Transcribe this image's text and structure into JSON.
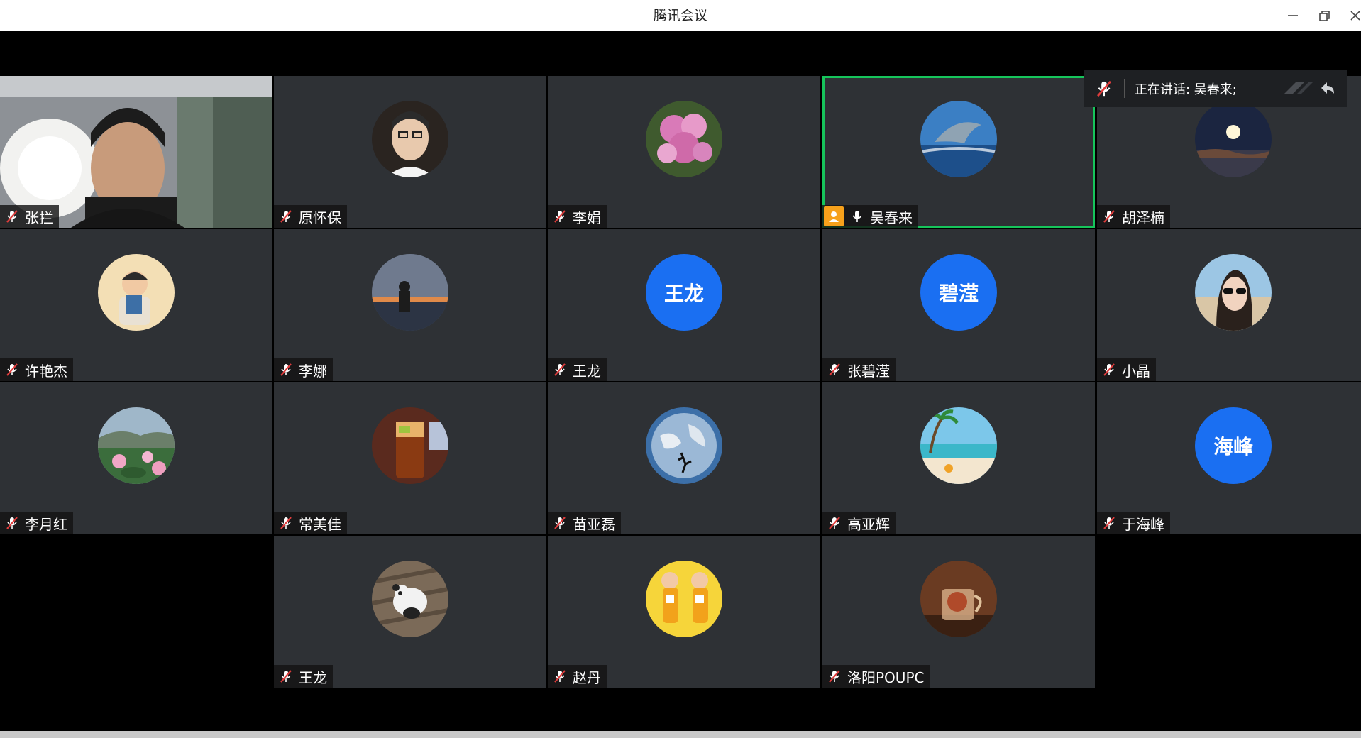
{
  "window": {
    "title": "腾讯会议"
  },
  "speaking": {
    "label": "正在讲话: 吴春来;"
  },
  "colors": {
    "active_border": "#16c55b",
    "text_avatar": "#1a6ff2",
    "host_badge": "#f6a11b",
    "tile_bg": "#2e3135"
  },
  "participants": [
    {
      "name": "张拦",
      "avatar": "video"
    },
    {
      "name": "原怀保",
      "avatar": "portrait"
    },
    {
      "name": "李娟",
      "avatar": "flowers"
    },
    {
      "name": "吴春来",
      "avatar": "dolphin",
      "host": true,
      "speaking": true
    },
    {
      "name": "胡泽楠",
      "avatar": "moon"
    },
    {
      "name": "许艳杰",
      "avatar": "baby"
    },
    {
      "name": "李娜",
      "avatar": "sunset"
    },
    {
      "name": "王龙",
      "avatar": "text",
      "avatar_text": "王龙"
    },
    {
      "name": "张碧滢",
      "avatar": "text",
      "avatar_text": "碧滢"
    },
    {
      "name": "小晶",
      "avatar": "woman"
    },
    {
      "name": "李月红",
      "avatar": "lotus"
    },
    {
      "name": "常美佳",
      "avatar": "drink"
    },
    {
      "name": "苗亚磊",
      "avatar": "earth"
    },
    {
      "name": "高亚辉",
      "avatar": "beach"
    },
    {
      "name": "于海峰",
      "avatar": "text",
      "avatar_text": "海峰"
    },
    {
      "name": "王龙",
      "avatar": "panda"
    },
    {
      "name": "赵丹",
      "avatar": "kids"
    },
    {
      "name": "洛阳POUPC",
      "avatar": "tea"
    }
  ]
}
